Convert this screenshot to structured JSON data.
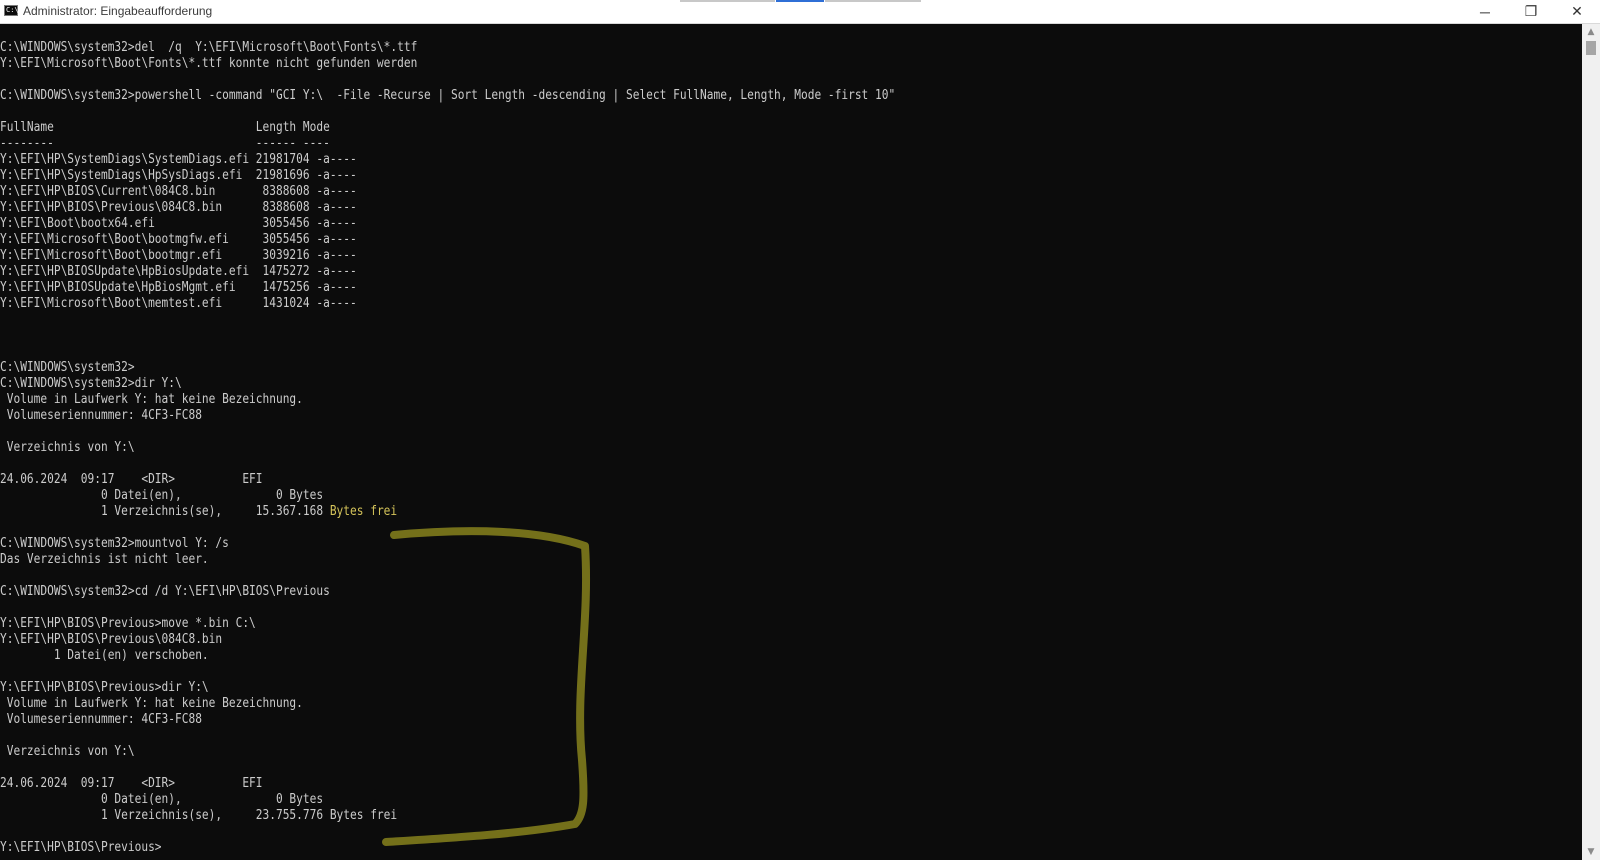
{
  "window": {
    "title": "Administrator: Eingabeaufforderung",
    "icon_label": "C:\\",
    "controls": {
      "minimize": "─",
      "restore": "❐",
      "close": "✕"
    }
  },
  "console": {
    "lines": [
      {
        "text": "",
        "highlight": ""
      },
      {
        "text": "C:\\WINDOWS\\system32>del  /q  Y:\\EFI\\Microsoft\\Boot\\Fonts\\*.ttf",
        "highlight": ""
      },
      {
        "text": "Y:\\EFI\\Microsoft\\Boot\\Fonts\\*.ttf konnte nicht gefunden werden",
        "highlight": ""
      },
      {
        "text": "",
        "highlight": ""
      },
      {
        "text": "C:\\WINDOWS\\system32>powershell -command \"GCI Y:\\  -File -Recurse | Sort Length -descending | Select FullName, Length, Mode -first 10\"",
        "highlight": ""
      },
      {
        "text": "",
        "highlight": ""
      },
      {
        "text": "FullName                              Length Mode",
        "highlight": ""
      },
      {
        "text": "--------                              ------ ----",
        "highlight": ""
      },
      {
        "text": "Y:\\EFI\\HP\\SystemDiags\\SystemDiags.efi 21981704 -a----",
        "highlight": ""
      },
      {
        "text": "Y:\\EFI\\HP\\SystemDiags\\HpSysDiags.efi  21981696 -a----",
        "highlight": ""
      },
      {
        "text": "Y:\\EFI\\HP\\BIOS\\Current\\084C8.bin       8388608 -a----",
        "highlight": ""
      },
      {
        "text": "Y:\\EFI\\HP\\BIOS\\Previous\\084C8.bin      8388608 -a----",
        "highlight": ""
      },
      {
        "text": "Y:\\EFI\\Boot\\bootx64.efi                3055456 -a----",
        "highlight": ""
      },
      {
        "text": "Y:\\EFI\\Microsoft\\Boot\\bootmgfw.efi     3055456 -a----",
        "highlight": ""
      },
      {
        "text": "Y:\\EFI\\Microsoft\\Boot\\bootmgr.efi      3039216 -a----",
        "highlight": ""
      },
      {
        "text": "Y:\\EFI\\HP\\BIOSUpdate\\HpBiosUpdate.efi  1475272 -a----",
        "highlight": ""
      },
      {
        "text": "Y:\\EFI\\HP\\BIOSUpdate\\HpBiosMgmt.efi    1475256 -a----",
        "highlight": ""
      },
      {
        "text": "Y:\\EFI\\Microsoft\\Boot\\memtest.efi      1431024 -a----",
        "highlight": ""
      },
      {
        "text": "",
        "highlight": ""
      },
      {
        "text": "",
        "highlight": ""
      },
      {
        "text": "",
        "highlight": ""
      },
      {
        "text": "C:\\WINDOWS\\system32>",
        "highlight": ""
      },
      {
        "text": "C:\\WINDOWS\\system32>dir Y:\\",
        "highlight": ""
      },
      {
        "text": " Volume in Laufwerk Y: hat keine Bezeichnung.",
        "highlight": ""
      },
      {
        "text": " Volumeseriennummer: 4CF3-FC88",
        "highlight": ""
      },
      {
        "text": "",
        "highlight": ""
      },
      {
        "text": " Verzeichnis von Y:\\",
        "highlight": ""
      },
      {
        "text": "",
        "highlight": ""
      },
      {
        "text": "24.06.2024  09:17    <DIR>          EFI",
        "highlight": ""
      },
      {
        "text": "               0 Datei(en),              0 Bytes",
        "highlight": ""
      },
      {
        "text": "               1 Verzeichnis(se),     15.367.168 ",
        "highlight": "Bytes frei"
      },
      {
        "text": "",
        "highlight": ""
      },
      {
        "text": "C:\\WINDOWS\\system32>mountvol Y: /s",
        "highlight": ""
      },
      {
        "text": "Das Verzeichnis ist nicht leer.",
        "highlight": ""
      },
      {
        "text": "",
        "highlight": ""
      },
      {
        "text": "C:\\WINDOWS\\system32>cd /d Y:\\EFI\\HP\\BIOS\\Previous",
        "highlight": ""
      },
      {
        "text": "",
        "highlight": ""
      },
      {
        "text": "Y:\\EFI\\HP\\BIOS\\Previous>move *.bin C:\\",
        "highlight": ""
      },
      {
        "text": "Y:\\EFI\\HP\\BIOS\\Previous\\084C8.bin",
        "highlight": ""
      },
      {
        "text": "        1 Datei(en) verschoben.",
        "highlight": ""
      },
      {
        "text": "",
        "highlight": ""
      },
      {
        "text": "Y:\\EFI\\HP\\BIOS\\Previous>dir Y:\\",
        "highlight": ""
      },
      {
        "text": " Volume in Laufwerk Y: hat keine Bezeichnung.",
        "highlight": ""
      },
      {
        "text": " Volumeseriennummer: 4CF3-FC88",
        "highlight": ""
      },
      {
        "text": "",
        "highlight": ""
      },
      {
        "text": " Verzeichnis von Y:\\",
        "highlight": ""
      },
      {
        "text": "",
        "highlight": ""
      },
      {
        "text": "24.06.2024  09:17    <DIR>          EFI",
        "highlight": ""
      },
      {
        "text": "               0 Datei(en),              0 Bytes",
        "highlight": ""
      },
      {
        "text": "               1 Verzeichnis(se),     23.755.776 Bytes frei",
        "highlight": ""
      },
      {
        "text": "",
        "highlight": ""
      },
      {
        "text": "Y:\\EFI\\HP\\BIOS\\Previous>",
        "highlight": ""
      }
    ]
  },
  "colors": {
    "console_bg": "#0c0c0c",
    "console_text": "#cccccc",
    "highlight_text": "#d4c35a",
    "annotation_stroke": "#8f8a1e",
    "tab_indicator_gray": "#c8c8c8",
    "tab_indicator_blue": "#2f6fd6"
  },
  "icons": {
    "app": "cmd-icon",
    "scroll_up": "arrow-up-icon",
    "scroll_down": "arrow-down-icon"
  }
}
